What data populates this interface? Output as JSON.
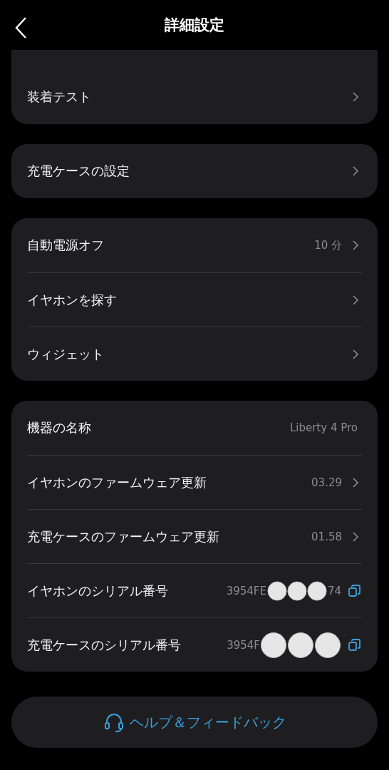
{
  "header": {
    "title": "詳細設定"
  },
  "cards": [
    {
      "cut_top": true,
      "rows": [
        {
          "kind": "nav",
          "label": "装着テスト"
        }
      ]
    },
    {
      "cut_top": false,
      "rows": [
        {
          "kind": "nav",
          "label": "充電ケースの設定"
        }
      ]
    },
    {
      "cut_top": false,
      "rows": [
        {
          "kind": "nav",
          "label": "自動電源オフ",
          "value": "10 分"
        },
        {
          "kind": "nav",
          "label": "イヤホンを探す"
        },
        {
          "kind": "nav",
          "label": "ウィジェット"
        }
      ]
    },
    {
      "cut_top": false,
      "rows": [
        {
          "kind": "info",
          "label": "機器の名称",
          "value": "Liberty 4 Pro"
        },
        {
          "kind": "nav",
          "label": "イヤホンのファームウェア更新",
          "value": "03.29"
        },
        {
          "kind": "nav",
          "label": "充電ケースのファームウェア更新",
          "value": "01.58"
        },
        {
          "kind": "serial",
          "label": "イヤホンのシリアル番号",
          "value": "3954FE",
          "value_tail": "74"
        },
        {
          "kind": "serial",
          "label": "充電ケースのシリアル番号",
          "value": "3954F"
        }
      ]
    }
  ],
  "help_button": {
    "label": "ヘルプ＆フィードバック"
  }
}
